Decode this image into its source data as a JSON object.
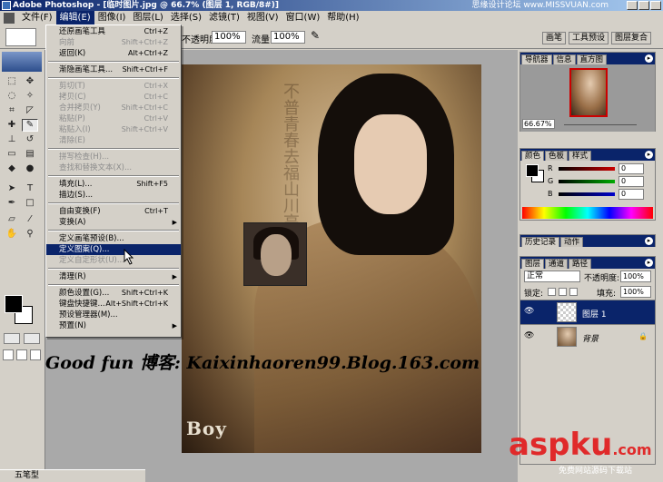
{
  "window": {
    "title": "Adobe Photoshop - [临时图片.jpg @ 66.7% (图层 1, RGB/8#)]",
    "watermark_top": "思缘设计论坛 www.MISSVUAN.com"
  },
  "menubar": {
    "items": [
      "文件(F)",
      "编辑(E)",
      "图像(I)",
      "图层(L)",
      "选择(S)",
      "滤镜(T)",
      "视图(V)",
      "窗口(W)",
      "帮助(H)"
    ],
    "active_index": 1
  },
  "options": {
    "opacity_label": "不透明度:",
    "opacity_value": "100%",
    "flow_label": "流量:",
    "flow_value": "100%",
    "tabs": [
      "画笔",
      "工具预设",
      "图层复合"
    ]
  },
  "edit_menu": {
    "items": [
      {
        "label": "还原画笔工具",
        "shortcut": "Ctrl+Z",
        "enabled": true
      },
      {
        "label": "向前",
        "shortcut": "Shift+Ctrl+Z",
        "enabled": false
      },
      {
        "label": "返回(K)",
        "shortcut": "Alt+Ctrl+Z",
        "enabled": true
      },
      {
        "sep": true
      },
      {
        "label": "渐隐画笔工具...",
        "shortcut": "Shift+Ctrl+F",
        "enabled": true
      },
      {
        "sep": true
      },
      {
        "label": "剪切(T)",
        "shortcut": "Ctrl+X",
        "enabled": false
      },
      {
        "label": "拷贝(C)",
        "shortcut": "Ctrl+C",
        "enabled": false
      },
      {
        "label": "合并拷贝(Y)",
        "shortcut": "Shift+Ctrl+C",
        "enabled": false
      },
      {
        "label": "粘贴(P)",
        "shortcut": "Ctrl+V",
        "enabled": false
      },
      {
        "label": "粘贴入(I)",
        "shortcut": "Shift+Ctrl+V",
        "enabled": false
      },
      {
        "label": "清除(E)",
        "shortcut": "",
        "enabled": false
      },
      {
        "sep": true
      },
      {
        "label": "拼写检查(H)...",
        "shortcut": "",
        "enabled": false
      },
      {
        "label": "查找和替换文本(X)...",
        "shortcut": "",
        "enabled": false
      },
      {
        "sep": true
      },
      {
        "label": "填充(L)...",
        "shortcut": "Shift+F5",
        "enabled": true
      },
      {
        "label": "描边(S)...",
        "shortcut": "",
        "enabled": true
      },
      {
        "sep": true
      },
      {
        "label": "自由变换(F)",
        "shortcut": "Ctrl+T",
        "enabled": true
      },
      {
        "label": "变换(A)",
        "shortcut": "",
        "enabled": true,
        "submenu": true
      },
      {
        "sep": true
      },
      {
        "label": "定义画笔预设(B)...",
        "shortcut": "",
        "enabled": true
      },
      {
        "label": "定义图案(Q)...",
        "shortcut": "",
        "enabled": true,
        "highlighted": true
      },
      {
        "label": "定义自定形状(U)...",
        "shortcut": "",
        "enabled": false
      },
      {
        "sep": true
      },
      {
        "label": "清理(R)",
        "shortcut": "",
        "enabled": true,
        "submenu": true
      },
      {
        "sep": true
      },
      {
        "label": "颜色设置(G)...",
        "shortcut": "Shift+Ctrl+K",
        "enabled": true
      },
      {
        "label": "键盘快捷键...",
        "shortcut": "Alt+Shift+Ctrl+K",
        "enabled": true
      },
      {
        "label": "预设管理器(M)...",
        "shortcut": "",
        "enabled": true
      },
      {
        "label": "预置(N)",
        "shortcut": "",
        "enabled": true,
        "submenu": true
      }
    ]
  },
  "canvas": {
    "overlay_text": "Good fun 博客: Kaixinhaoren99.Blog.163.com",
    "logo_text": "Boy",
    "calligraphy": "不普青春去福山川高"
  },
  "navigator": {
    "tabs": [
      "导航器",
      "信息",
      "直方图"
    ],
    "zoom": "66.67%"
  },
  "color_panel": {
    "tabs": [
      "颜色",
      "色板",
      "样式"
    ],
    "channels": [
      {
        "name": "R",
        "value": "0",
        "color": "#cc0000"
      },
      {
        "name": "G",
        "value": "0",
        "color": "#00aa00"
      },
      {
        "name": "B",
        "value": "0",
        "color": "#0000cc"
      }
    ]
  },
  "history_panel": {
    "tabs": [
      "历史记录",
      "动作"
    ]
  },
  "layers_panel": {
    "tabs": [
      "图层",
      "通道",
      "路径"
    ],
    "blend_mode": "正常",
    "opacity_label": "不透明度:",
    "opacity_value": "100%",
    "lock_label": "锁定:",
    "fill_label": "填充:",
    "fill_value": "100%",
    "layers": [
      {
        "name": "图层 1",
        "selected": true
      },
      {
        "name": "背景",
        "selected": false
      }
    ]
  },
  "statusbar": {
    "text": "五笔型"
  },
  "watermark": {
    "brand": "aspku",
    "brand_suffix": ".com",
    "sub": "免费网站源码下载站"
  },
  "colors": {
    "title_blue": "#0a246a",
    "menu_bg": "#d4d0c8",
    "brand_red": "#e02a2a"
  }
}
